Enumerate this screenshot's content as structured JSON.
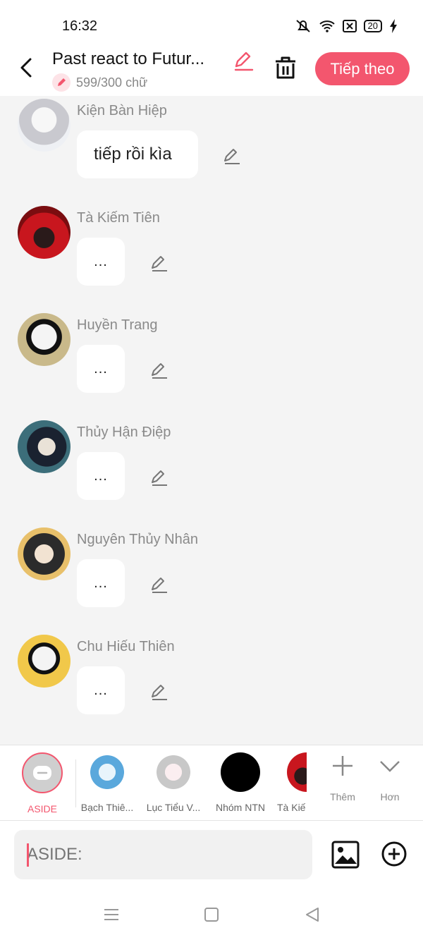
{
  "status": {
    "time": "16:32",
    "battery": "20"
  },
  "header": {
    "title": "Past react to Futur...",
    "wordcount": "599/300 chữ",
    "next_label": "Tiếp theo"
  },
  "messages": [
    {
      "name": "Kiện Bàn Hiệp",
      "text": "tiếp rồi kìa"
    },
    {
      "name": "Tà Kiếm Tiên",
      "text": "..."
    },
    {
      "name": "Huyền Trang",
      "text": "..."
    },
    {
      "name": "Thủy Hận Điệp",
      "text": "..."
    },
    {
      "name": "Nguyên Thủy Nhân",
      "text": "..."
    },
    {
      "name": "Chu Hiếu Thiên",
      "text": "..."
    }
  ],
  "characters": [
    {
      "label": "ASIDE"
    },
    {
      "label": "Bạch Thiê..."
    },
    {
      "label": "Lục Tiểu V..."
    },
    {
      "label": "Nhóm NTN"
    },
    {
      "label": "Tà Kiế"
    }
  ],
  "tools": {
    "add_label": "Thêm",
    "more_label": "Hơn"
  },
  "input": {
    "placeholder": "ASIDE:"
  },
  "colors": {
    "accent": "#f3566e",
    "background": "#f4f4f4"
  },
  "icons": [
    "back-arrow-icon",
    "pencil-icon",
    "trash-icon",
    "edit-icon",
    "image-icon",
    "plus-circle-icon",
    "menu-icon",
    "home-square-icon",
    "back-triangle-icon"
  ]
}
